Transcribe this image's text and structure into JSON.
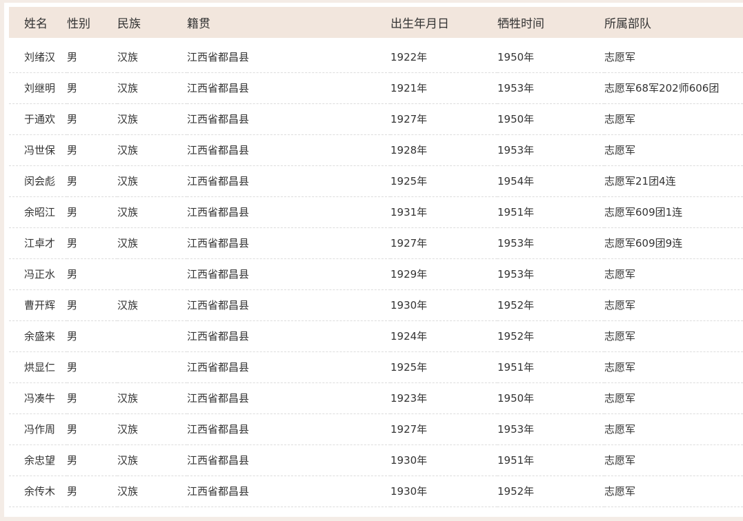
{
  "table": {
    "headers": [
      "姓名",
      "性别",
      "民族",
      "籍贯",
      "出生年月日",
      "牺牲时间",
      "所属部队"
    ],
    "rows": [
      [
        "刘绪汉",
        "男",
        "汉族",
        "江西省都昌县",
        "1922年",
        "1950年",
        "志愿军"
      ],
      [
        "刘继明",
        "男",
        "汉族",
        "江西省都昌县",
        "1921年",
        "1953年",
        "志愿军68军202师606团"
      ],
      [
        "于通欢",
        "男",
        "汉族",
        "江西省都昌县",
        "1927年",
        "1950年",
        "志愿军"
      ],
      [
        "冯世保",
        "男",
        "汉族",
        "江西省都昌县",
        "1928年",
        "1953年",
        "志愿军"
      ],
      [
        "闵会彪",
        "男",
        "汉族",
        "江西省都昌县",
        "1925年",
        "1954年",
        "志愿军21团4连"
      ],
      [
        "余昭江",
        "男",
        "汉族",
        "江西省都昌县",
        "1931年",
        "1951年",
        "志愿军609团1连"
      ],
      [
        "江卓才",
        "男",
        "汉族",
        "江西省都昌县",
        "1927年",
        "1953年",
        "志愿军609团9连"
      ],
      [
        "冯正水",
        "男",
        "",
        "江西省都昌县",
        "1929年",
        "1953年",
        "志愿军"
      ],
      [
        "曹开辉",
        "男",
        "汉族",
        "江西省都昌县",
        "1930年",
        "1952年",
        "志愿军"
      ],
      [
        "余盛来",
        "男",
        "",
        "江西省都昌县",
        "1924年",
        "1952年",
        "志愿军"
      ],
      [
        "烘显仁",
        "男",
        "",
        "江西省都昌县",
        "1925年",
        "1951年",
        "志愿军"
      ],
      [
        "冯凑牛",
        "男",
        "汉族",
        "江西省都昌县",
        "1923年",
        "1950年",
        "志愿军"
      ],
      [
        "冯作周",
        "男",
        "汉族",
        "江西省都昌县",
        "1927年",
        "1953年",
        "志愿军"
      ],
      [
        "余忠望",
        "男",
        "汉族",
        "江西省都昌县",
        "1930年",
        "1951年",
        "志愿军"
      ],
      [
        "余传木",
        "男",
        "汉族",
        "江西省都昌县",
        "1930年",
        "1952年",
        "志愿军"
      ]
    ]
  },
  "colors": {
    "page_background": "#f4ece6",
    "header_background": "#f2e6dd",
    "text": "#333333",
    "row_divider": "#dcdcdc"
  }
}
